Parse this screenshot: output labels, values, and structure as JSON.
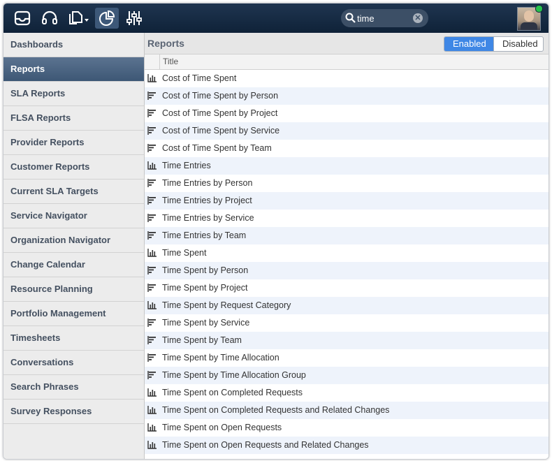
{
  "topbar": {
    "icons": [
      "inbox-icon",
      "headset-icon",
      "new-document-icon",
      "reports-pie-chart-icon",
      "settings-sliders-icon"
    ],
    "search": {
      "value": "time",
      "icon": "search-icon",
      "clear_icon": "clear-icon"
    },
    "user": {
      "status": "online",
      "status_color": "#27c24c"
    }
  },
  "sidebar": {
    "items": [
      {
        "label": "Dashboards"
      },
      {
        "label": "Reports",
        "active": true
      },
      {
        "label": "SLA Reports"
      },
      {
        "label": "FLSA Reports"
      },
      {
        "label": "Provider Reports"
      },
      {
        "label": "Customer Reports"
      },
      {
        "label": "Current SLA Targets"
      },
      {
        "label": "Service Navigator"
      },
      {
        "label": "Organization Navigator"
      },
      {
        "label": "Change Calendar"
      },
      {
        "label": "Resource Planning"
      },
      {
        "label": "Portfolio Management"
      },
      {
        "label": "Timesheets"
      },
      {
        "label": "Conversations"
      },
      {
        "label": "Search Phrases"
      },
      {
        "label": "Survey Responses"
      }
    ]
  },
  "main": {
    "title": "Reports",
    "toggle": {
      "enabled": "Enabled",
      "disabled": "Disabled",
      "selected": "Enabled",
      "accent": "#3f87e5"
    },
    "columns": {
      "title": "Title"
    },
    "rows": [
      {
        "title": "Cost of Time Spent",
        "icon": "bar-chart-icon"
      },
      {
        "title": "Cost of Time Spent by Person",
        "icon": "horizontal-bar-chart-icon"
      },
      {
        "title": "Cost of Time Spent by Project",
        "icon": "horizontal-bar-chart-icon"
      },
      {
        "title": "Cost of Time Spent by Service",
        "icon": "horizontal-bar-chart-icon"
      },
      {
        "title": "Cost of Time Spent by Team",
        "icon": "horizontal-bar-chart-icon"
      },
      {
        "title": "Time Entries",
        "icon": "bar-chart-icon"
      },
      {
        "title": "Time Entries by Person",
        "icon": "horizontal-bar-chart-icon"
      },
      {
        "title": "Time Entries by Project",
        "icon": "horizontal-bar-chart-icon"
      },
      {
        "title": "Time Entries by Service",
        "icon": "horizontal-bar-chart-icon"
      },
      {
        "title": "Time Entries by Team",
        "icon": "horizontal-bar-chart-icon"
      },
      {
        "title": "Time Spent",
        "icon": "bar-chart-icon"
      },
      {
        "title": "Time Spent by Person",
        "icon": "horizontal-bar-chart-icon"
      },
      {
        "title": "Time Spent by Project",
        "icon": "horizontal-bar-chart-icon"
      },
      {
        "title": "Time Spent by Request Category",
        "icon": "bar-chart-icon"
      },
      {
        "title": "Time Spent by Service",
        "icon": "horizontal-bar-chart-icon"
      },
      {
        "title": "Time Spent by Team",
        "icon": "horizontal-bar-chart-icon"
      },
      {
        "title": "Time Spent by Time Allocation",
        "icon": "horizontal-bar-chart-icon"
      },
      {
        "title": "Time Spent by Time Allocation Group",
        "icon": "horizontal-bar-chart-icon"
      },
      {
        "title": "Time Spent on Completed Requests",
        "icon": "bar-chart-icon"
      },
      {
        "title": "Time Spent on Completed Requests and Related Changes",
        "icon": "bar-chart-icon"
      },
      {
        "title": "Time Spent on Open Requests",
        "icon": "bar-chart-icon"
      },
      {
        "title": "Time Spent on Open Requests and Related Changes",
        "icon": "bar-chart-icon"
      }
    ]
  }
}
